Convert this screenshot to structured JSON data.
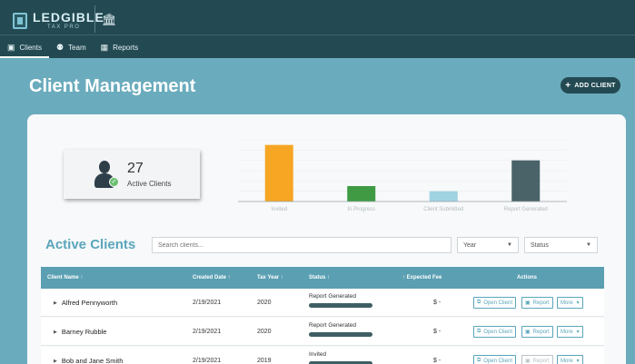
{
  "brand": {
    "name": "LEDGIBLE",
    "sub": "TAX PRO"
  },
  "icons": {
    "bank": "bank-icon",
    "clients": "id-card-icon",
    "team": "people-icon",
    "reports": "chart-icon"
  },
  "nav": [
    {
      "label": "Clients",
      "icon": "▣"
    },
    {
      "label": "Team",
      "icon": "⚉"
    },
    {
      "label": "Reports",
      "icon": "▦"
    }
  ],
  "page": {
    "title": "Client Management",
    "add_button": "ADD CLIENT"
  },
  "stat": {
    "count": "27",
    "label": "Active Clients"
  },
  "chart_data": {
    "type": "bar",
    "categories": [
      "Invited",
      "In Progress",
      "Client Submitted",
      "Report Generated"
    ],
    "values": [
      11,
      3,
      2,
      8
    ],
    "colors": [
      "#f6a623",
      "#3f9a43",
      "#9fd3e1",
      "#4a6369"
    ],
    "ylim": [
      0,
      12
    ],
    "grid": true
  },
  "active_clients": {
    "title": "Active Clients",
    "search_placeholder": "Search clients...",
    "year_select": "Year",
    "status_select": "Status"
  },
  "table": {
    "headers": [
      "Client Name ↑",
      "Created Date ↑",
      "Tax Year ↑",
      "Status ↑",
      "↑ Expected Fee",
      "Actions"
    ],
    "rows": [
      {
        "name": "Alfred Pennyworth",
        "created": "2/19/2021",
        "year": "2020",
        "status": "Report Generated",
        "fee": "$ -"
      },
      {
        "name": "Barney Rubble",
        "created": "2/19/2021",
        "year": "2020",
        "status": "Report Generated",
        "fee": "$ -"
      },
      {
        "name": "Bob and Jane Smith",
        "created": "2/19/2021",
        "year": "2019",
        "status": "Invited",
        "fee": "$ -"
      }
    ],
    "actions": {
      "open": "Open Client",
      "report": "Report",
      "more": "More"
    }
  }
}
